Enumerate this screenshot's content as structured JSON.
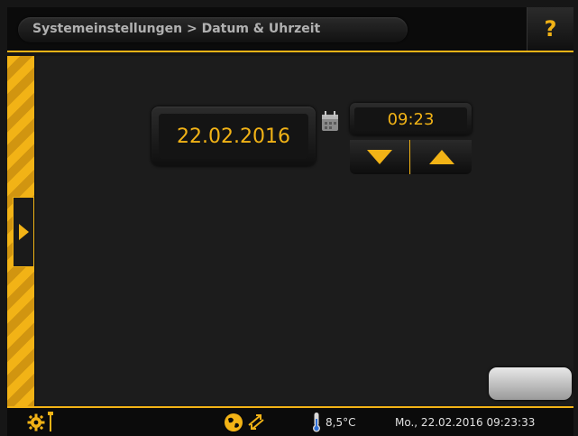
{
  "header": {
    "title": "Systemeinstellungen > Datum & Uhrzeit",
    "help_label": "?"
  },
  "date": {
    "value": "22.02.2016"
  },
  "time": {
    "value": "09:23"
  },
  "status": {
    "temperature": "8,5°C",
    "datetime": "Mo., 22.02.2016 09:23:33"
  },
  "colors": {
    "accent": "#f2b316",
    "background": "#1c1c1c",
    "text": "#e0e0e0"
  },
  "icons": [
    "gear-icon",
    "wrench-icon",
    "globe-icon",
    "exchange-arrows-icon",
    "thermometer-icon",
    "calendar-icon",
    "chevron-right-icon",
    "arrow-down-icon",
    "arrow-up-icon"
  ]
}
